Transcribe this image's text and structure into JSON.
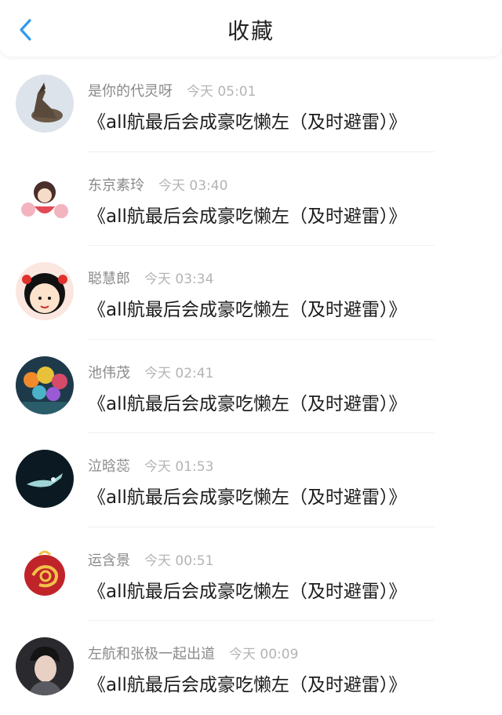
{
  "header": {
    "title": "收藏",
    "back_icon": "chevron-left-icon",
    "accent_color": "#2f9af0"
  },
  "items": [
    {
      "user": "是你的代灵呀",
      "time": "今天 05:01",
      "title": "《all航最后会成豪吃懒左（及时避雷）》",
      "avatar": "wolf-avatar"
    },
    {
      "user": "东京素玲",
      "time": "今天 03:40",
      "title": "《all航最后会成豪吃懒左（及时避雷）》",
      "avatar": "anime-girl-avatar"
    },
    {
      "user": "聪慧郎",
      "time": "今天 03:34",
      "title": "《all航最后会成豪吃懒左（及时避雷）》",
      "avatar": "cartoon-girl-avatar"
    },
    {
      "user": "池伟茂",
      "time": "今天 02:41",
      "title": "《all航最后会成豪吃懒左（及时避雷）》",
      "avatar": "balloons-avatar"
    },
    {
      "user": "泣晗蕊",
      "time": "今天 01:53",
      "title": "《all航最后会成豪吃懒左（及时避雷）》",
      "avatar": "dark-figure-avatar"
    },
    {
      "user": "运含景",
      "time": "今天 00:51",
      "title": "《all航最后会成豪吃懒左（及时避雷）》",
      "avatar": "red-emblem-avatar"
    },
    {
      "user": "左航和张极一起出道",
      "time": "今天 00:09",
      "title": "《all航最后会成豪吃懒左（及时避雷）》",
      "avatar": "portrait-avatar"
    }
  ]
}
